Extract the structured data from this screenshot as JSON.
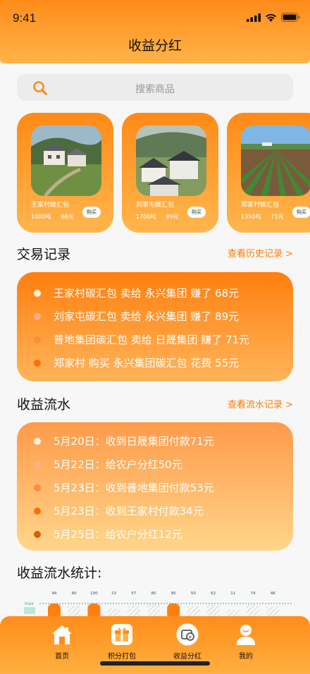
{
  "status": {
    "time": "9:41"
  },
  "page": {
    "title": "收益分红"
  },
  "search": {
    "placeholder": "搜索商品"
  },
  "products": [
    {
      "name": "王家村碳汇包",
      "amount": "1000吨",
      "price": "68元",
      "buy": "购买"
    },
    {
      "name": "刘家屯碳汇包",
      "amount": "1700吨",
      "price": "89元",
      "buy": "购买"
    },
    {
      "name": "郑家村碳汇包",
      "amount": "1350吨",
      "price": "71元",
      "buy": "购买"
    }
  ],
  "trades": {
    "title": "交易记录",
    "link": "查看历史记录 >",
    "items": [
      "王家村碳汇包 卖给 永兴集团 赚了 68元",
      "刘家屯碳汇包 卖给 永兴集团 赚了 89元",
      "普地集团碳汇包 卖给 日晟集团 赚了 71元",
      "郑家村 购买 永兴集团碳汇包 花费 55元"
    ]
  },
  "flow": {
    "title": "收益流水",
    "link": "查看流水记录 >",
    "items": [
      "5月20日：收到日晟集团付款71元",
      "5月22日：给农户分红50元",
      "5月23日：收到普地集团付款53元",
      "5月23日：收到王家村付款34元",
      "5月25日：给农户分红12元"
    ]
  },
  "stats": {
    "title": "收益流水统计:"
  },
  "chart_data": {
    "type": "bar",
    "title": "",
    "xlabel": "",
    "ylabel": "",
    "y_marker_label": "max",
    "values": [
      94,
      60,
      100,
      23,
      57,
      80,
      95,
      50,
      62,
      11,
      74,
      48
    ]
  },
  "tabbar": {
    "items": [
      {
        "label": "首页",
        "icon": "home-icon"
      },
      {
        "label": "积分打包",
        "icon": "package-icon"
      },
      {
        "label": "收益分红",
        "icon": "dividend-icon"
      },
      {
        "label": "我的",
        "icon": "user-icon"
      }
    ]
  },
  "colors": {
    "accent": "#ff8a17",
    "accent_light": "#ffb64d",
    "dot_white": "#fff3d6",
    "dot_peach": "#ffb088",
    "dot_orange": "#ff8c3a",
    "dot_deep": "#ff6e0a",
    "dot_brown": "#d95f00"
  }
}
